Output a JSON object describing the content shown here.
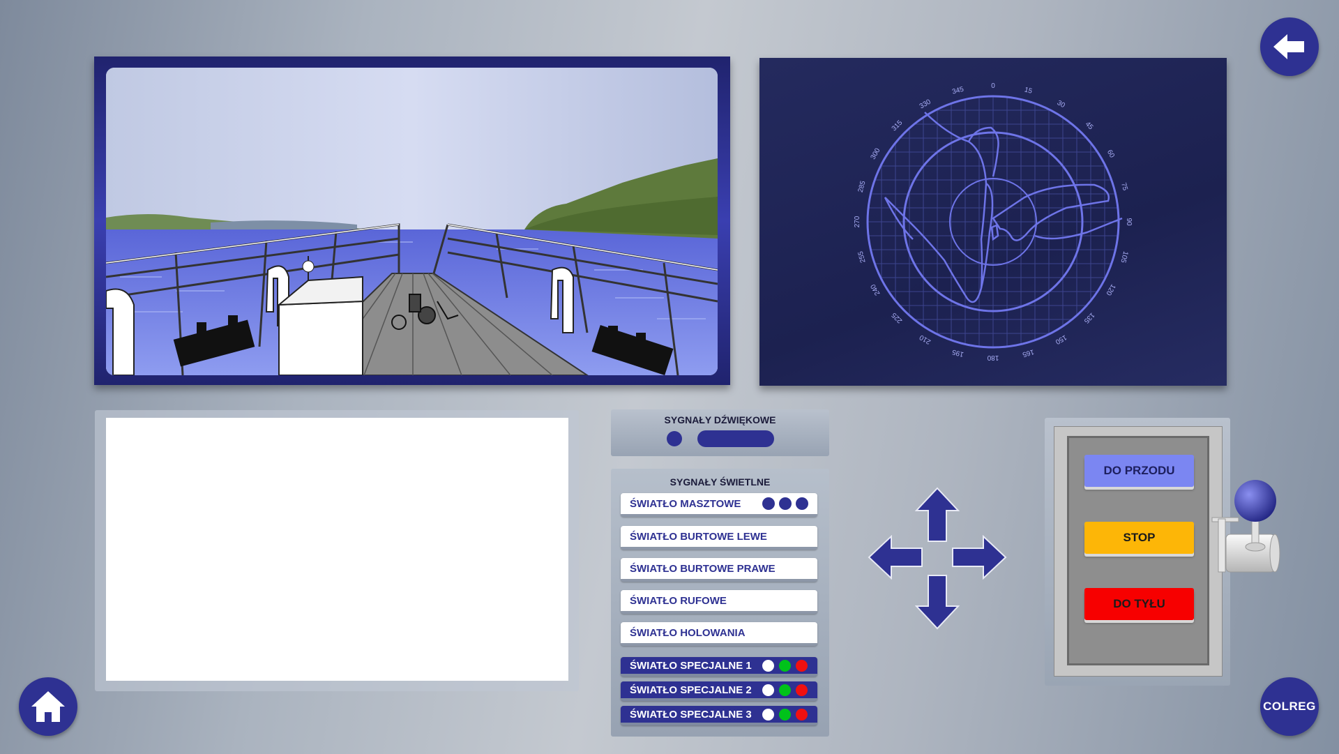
{
  "navigation": {
    "back_icon": "arrow-left-icon",
    "home_icon": "home-icon",
    "colreg_label": "COLREG"
  },
  "radar": {
    "bearing_labels": [
      "0",
      "15",
      "30",
      "45",
      "60",
      "75",
      "90",
      "105",
      "120",
      "135",
      "150",
      "165",
      "180",
      "195",
      "210",
      "225",
      "240",
      "255",
      "270",
      "285",
      "300",
      "315",
      "330",
      "345"
    ],
    "color": "#6e74e8"
  },
  "sound_signals": {
    "title": "SYGNAŁY DŹWIĘKOWE",
    "short_horn_icon": "short-blast-dot",
    "long_horn_icon": "long-blast-bar"
  },
  "light_signals": {
    "title": "SYGNAŁY ŚWIETLNE",
    "mast_light": {
      "label": "ŚWIATŁO MASZTOWE",
      "indicator_colors": [
        "#2e3192",
        "#2e3192",
        "#2e3192"
      ]
    },
    "side_left": {
      "label": "ŚWIATŁO BURTOWE LEWE"
    },
    "side_right": {
      "label": "ŚWIATŁO BURTOWE PRAWE"
    },
    "stern": {
      "label": "ŚWIATŁO RUFOWE"
    },
    "towing": {
      "label": "ŚWIATŁO HOLOWANIA"
    },
    "special": [
      {
        "label": "ŚWIATŁO SPECJALNE 1",
        "colors": [
          "#ffffff",
          "#00c21a",
          "#f01010"
        ]
      },
      {
        "label": "ŚWIATŁO SPECJALNE 2",
        "colors": [
          "#ffffff",
          "#00c21a",
          "#f01010"
        ]
      },
      {
        "label": "ŚWIATŁO SPECJALNE 3",
        "colors": [
          "#ffffff",
          "#00c21a",
          "#f01010"
        ]
      }
    ]
  },
  "direction_pad": {
    "up_icon": "arrow-up-icon",
    "down_icon": "arrow-down-icon",
    "left_icon": "arrow-left-icon",
    "right_icon": "arrow-right-icon",
    "color": "#2e3192"
  },
  "engine": {
    "forward": {
      "label": "DO PRZODU",
      "color": "#7b86f2"
    },
    "stop": {
      "label": "STOP",
      "color": "#fdb607"
    },
    "reverse": {
      "label": "DO TYŁU",
      "color": "#f70000"
    }
  },
  "message": {
    "text": ""
  },
  "colors": {
    "accent": "#2e3192"
  }
}
